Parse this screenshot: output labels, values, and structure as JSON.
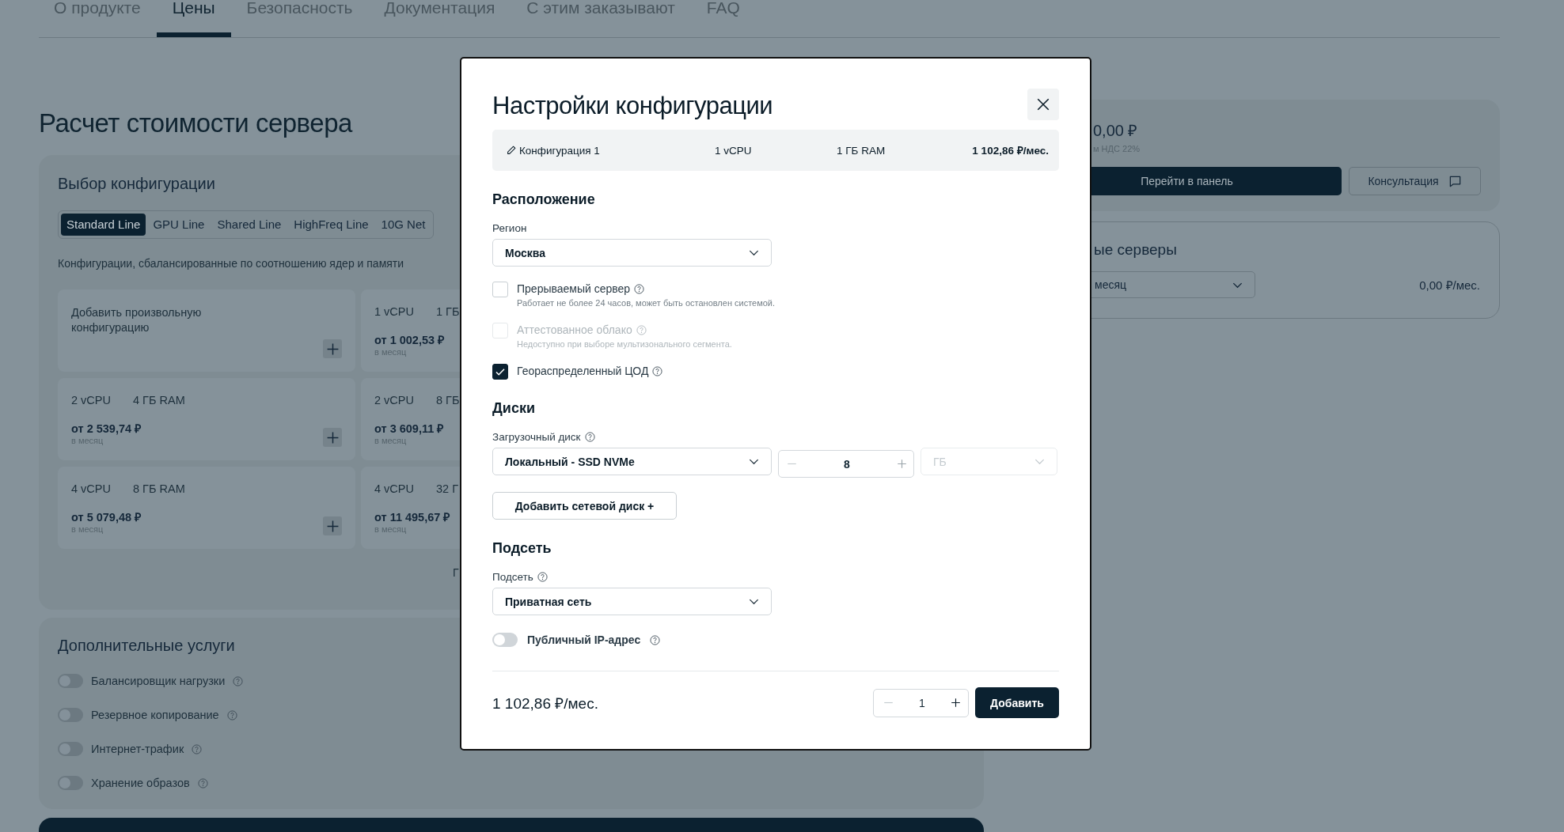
{
  "nav": {
    "tabs": [
      {
        "label": "О продукте",
        "selected": false
      },
      {
        "label": "Цены",
        "selected": true
      },
      {
        "label": "Безопасность",
        "selected": false
      },
      {
        "label": "Документация",
        "selected": false
      },
      {
        "label": "С этим заказывают",
        "selected": false
      },
      {
        "label": "FAQ",
        "selected": false
      }
    ]
  },
  "page_title": "Расчет стоимости сервера",
  "configurator": {
    "title": "Выбор конфигурации",
    "lines": [
      {
        "label": "Standard Line",
        "selected": true
      },
      {
        "label": "GPU Line",
        "selected": false
      },
      {
        "label": "Shared Line",
        "selected": false
      },
      {
        "label": "HighFreq Line",
        "selected": false
      },
      {
        "label": "10G Net",
        "selected": false
      }
    ],
    "description": "Конфигурации, сбалансированные по соотношению ядер и памяти",
    "cards": [
      {
        "kind": "custom",
        "label": "Добавить произвольную конфигурацию",
        "add_button": true
      },
      {
        "kind": "preset",
        "cpu": "1 vCPU",
        "ram": "1 ГБ",
        "price": "от 1 002,53 ₽",
        "period": "в месяц"
      },
      {
        "kind": "preset",
        "cpu": "2 vCPU",
        "ram": "4 ГБ RAM",
        "price": "от 2 539,74 ₽",
        "period": "в месяц",
        "add_button": true
      },
      {
        "kind": "preset",
        "cpu": "2 vCPU",
        "ram": "8 ГБ",
        "price": "от 3 609,11 ₽",
        "period": "в месяц"
      },
      {
        "kind": "preset",
        "cpu": "4 vCPU",
        "ram": "8 ГБ RAM",
        "price": "от 5 079,48 ₽",
        "period": "в месяц",
        "add_button": true
      },
      {
        "kind": "preset",
        "cpu": "4 vCPU",
        "ram": "32 Г",
        "price": "от 11 495,67 ₽",
        "period": "в месяц"
      }
    ],
    "more_link": "Г"
  },
  "services": {
    "title": "Дополнительные услуги",
    "items": [
      {
        "label": "Балансировщик нагрузки",
        "on": false
      },
      {
        "label": "Резервное копирование",
        "on": false
      },
      {
        "label": "Интернет-трафик",
        "on": false
      },
      {
        "label": "Хранение образов",
        "on": false
      }
    ]
  },
  "summary": {
    "total": "0,00 ₽",
    "vat_note": "м НДС 22%",
    "buttons": [
      {
        "label": "Перейти в панель",
        "kind": "primary"
      },
      {
        "label": "Консультация",
        "kind": "secondary"
      }
    ]
  },
  "reserved": {
    "title": "ые серверы",
    "period": "месяц",
    "price": "0,00 ₽/мес."
  },
  "modal": {
    "title": "Настройки конфигурации",
    "summary": {
      "name": "Конфигурация 1",
      "cpu": "1 vCPU",
      "ram": "1 ГБ RAM",
      "price": "1 102,86 ₽/мес."
    },
    "location": {
      "heading": "Расположение",
      "region_label": "Регион",
      "region": "Москва",
      "options": [
        {
          "label": "Прерываемый сервер",
          "hint": "Работает не более 24 часов, может быть остановлен системой.",
          "checked": false,
          "disabled": false
        },
        {
          "label": "Аттестованное облако",
          "hint": "Недоступно при выборе мультизонального сегмента.",
          "checked": false,
          "disabled": true
        },
        {
          "label": "Геораспределенный ЦОД",
          "checked": true,
          "disabled": false
        }
      ]
    },
    "disks": {
      "heading": "Диски",
      "boot_label": "Загрузочный диск",
      "boot_type": "Локальный - SSD NVMe",
      "size": "8",
      "decrement_disabled": true,
      "unit": "ГБ",
      "unit_disabled": true,
      "add_button": "Добавить сетевой диск +"
    },
    "subnet": {
      "heading": "Подсеть",
      "label": "Подсеть",
      "value": "Приватная сеть",
      "public_ip": {
        "label": "Публичный IP-адрес",
        "on": false
      }
    },
    "footer": {
      "price": "1 102,86 ₽/мес.",
      "quantity": "1",
      "decrement_disabled": true,
      "add_button": "Добавить"
    }
  }
}
